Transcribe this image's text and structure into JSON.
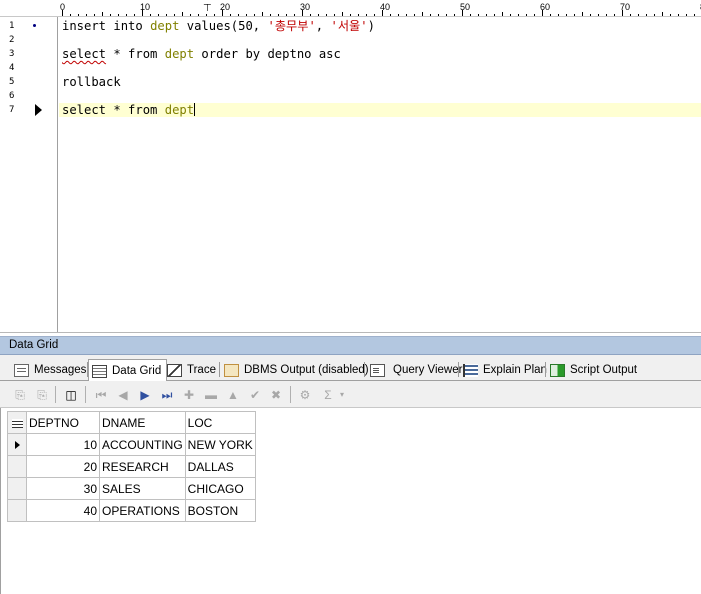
{
  "editor": {
    "ruler": {
      "labels": [
        "0",
        "10",
        "20",
        "30",
        "40",
        "50",
        "60",
        "70",
        "8"
      ]
    },
    "lines": [
      {
        "number": "1",
        "parts": [
          {
            "t": "insert into ",
            "c": "kw"
          },
          {
            "t": "dept",
            "c": "tbl"
          },
          {
            "t": " values(50, ",
            "c": "kw"
          },
          {
            "t": "'총무부'",
            "c": "str"
          },
          {
            "t": ", ",
            "c": "kw"
          },
          {
            "t": "'서울'",
            "c": "str"
          },
          {
            "t": ")",
            "c": "kw"
          }
        ]
      },
      {
        "number": "2",
        "parts": []
      },
      {
        "number": "3",
        "parts": [
          {
            "t": "select",
            "c": "kw squiggle"
          },
          {
            "t": " * from ",
            "c": "kw"
          },
          {
            "t": "dept",
            "c": "tbl"
          },
          {
            "t": " order by deptno asc",
            "c": "kw"
          }
        ]
      },
      {
        "number": "4",
        "parts": []
      },
      {
        "number": "5",
        "parts": [
          {
            "t": "rollback",
            "c": "kw"
          }
        ]
      },
      {
        "number": "6",
        "parts": []
      },
      {
        "number": "7",
        "parts": [
          {
            "t": "select * from ",
            "c": "kw"
          },
          {
            "t": "dept",
            "c": "tbl"
          }
        ]
      }
    ]
  },
  "panel": {
    "title": "Data Grid",
    "tabs": [
      {
        "label": "Messages",
        "icon": "messages-icon"
      },
      {
        "label": "Data Grid",
        "icon": "data-grid-icon"
      },
      {
        "label": "Trace",
        "icon": "trace-icon"
      },
      {
        "label": "DBMS Output (disabled)",
        "icon": "dbms-output-icon"
      },
      {
        "label": "Query Viewer",
        "icon": "query-viewer-icon"
      },
      {
        "label": "Explain Plan",
        "icon": "explain-plan-icon"
      },
      {
        "label": "Script Output",
        "icon": "script-output-icon"
      }
    ],
    "active_tab": "Data Grid"
  },
  "grid": {
    "columns": [
      "DEPTNO",
      "DNAME",
      "LOC"
    ],
    "rows": [
      [
        "10",
        "ACCOUNTING",
        "NEW YORK"
      ],
      [
        "20",
        "RESEARCH",
        "DALLAS"
      ],
      [
        "30",
        "SALES",
        "CHICAGO"
      ],
      [
        "40",
        "OPERATIONS",
        "BOSTON"
      ]
    ]
  },
  "colors": {
    "keyword": "#000000",
    "table_name": "#808000",
    "string_literal": "#c00000",
    "current_line": "#ffffd2",
    "panel_title_bg": "#b3c7e0"
  }
}
